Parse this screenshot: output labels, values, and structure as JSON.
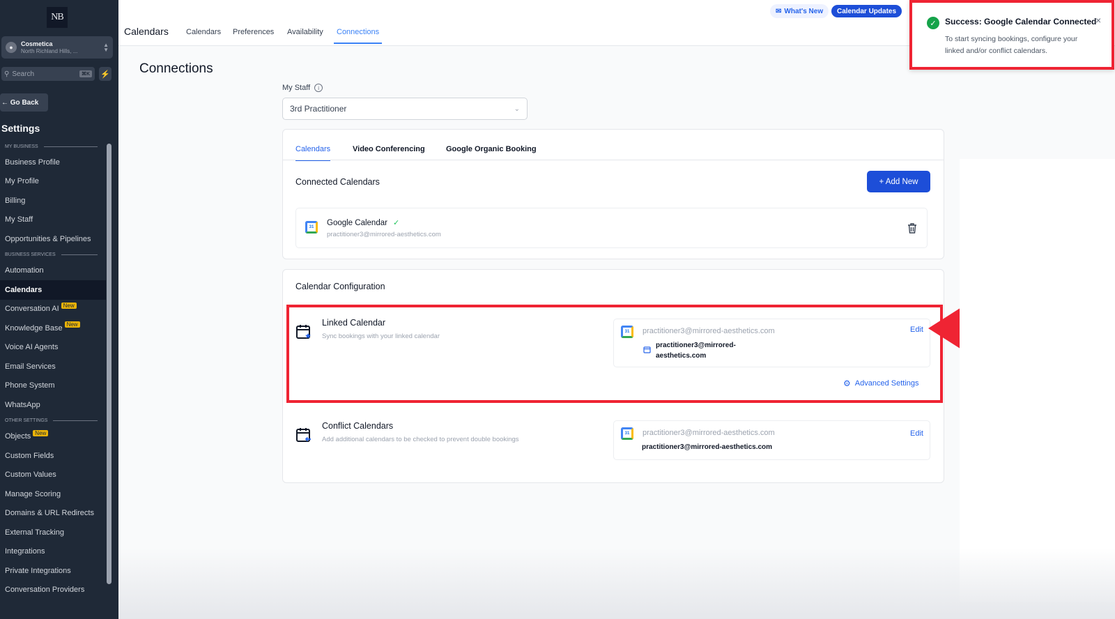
{
  "sidebar": {
    "logo": "NB",
    "account": {
      "name": "Cosmetica",
      "location": "North Richland Hills, ..."
    },
    "search": {
      "placeholder": "Search",
      "shortcut": "⌘K"
    },
    "go_back": "← Go Back",
    "title": "Settings",
    "sections": [
      {
        "label": "MY BUSINESS",
        "items": [
          {
            "label": "Business Profile"
          },
          {
            "label": "My Profile"
          },
          {
            "label": "Billing"
          },
          {
            "label": "My Staff"
          },
          {
            "label": "Opportunities & Pipelines"
          }
        ]
      },
      {
        "label": "BUSINESS SERVICES",
        "items": [
          {
            "label": "Automation"
          },
          {
            "label": "Calendars",
            "active": true
          },
          {
            "label": "Conversation AI",
            "badge": "New"
          },
          {
            "label": "Knowledge Base",
            "badge": "New"
          },
          {
            "label": "Voice AI Agents"
          },
          {
            "label": "Email Services"
          },
          {
            "label": "Phone System"
          },
          {
            "label": "WhatsApp"
          }
        ]
      },
      {
        "label": "OTHER SETTINGS",
        "items": [
          {
            "label": "Objects",
            "badge": "New"
          },
          {
            "label": "Custom Fields"
          },
          {
            "label": "Custom Values"
          },
          {
            "label": "Manage Scoring"
          },
          {
            "label": "Domains & URL Redirects"
          },
          {
            "label": "External Tracking"
          },
          {
            "label": "Integrations"
          },
          {
            "label": "Private Integrations"
          },
          {
            "label": "Conversation Providers"
          }
        ]
      }
    ]
  },
  "topbar": {
    "title": "Calendars",
    "tabs": [
      "Calendars",
      "Preferences",
      "Availability",
      "Connections"
    ],
    "active_tab": "Connections",
    "whats_new": "What's New",
    "calendar_updates": "Calendar Updates"
  },
  "page": {
    "heading": "Connections"
  },
  "staff": {
    "label": "My Staff",
    "selected": "3rd Practitioner"
  },
  "connections": {
    "tabs": [
      "Calendars",
      "Video Conferencing",
      "Google Organic Booking"
    ],
    "connected_title": "Connected Calendars",
    "add_new": "+ Add New",
    "google": {
      "name": "Google Calendar",
      "email": "practitioner3@mirrored-aesthetics.com"
    }
  },
  "config": {
    "title": "Calendar Configuration",
    "linked": {
      "title": "Linked Calendar",
      "desc": "Sync bookings with your linked calendar",
      "account": "practitioner3@mirrored-aesthetics.com",
      "calendar_line1": "practitioner3@mirrored-",
      "calendar_line2": "aesthetics.com",
      "edit": "Edit",
      "advanced": "Advanced Settings"
    },
    "conflict": {
      "title": "Conflict Calendars",
      "desc": "Add additional calendars to be checked to prevent double bookings",
      "account": "practitioner3@mirrored-aesthetics.com",
      "calendar": "practitioner3@mirrored-aesthetics.com",
      "edit": "Edit"
    }
  },
  "toast": {
    "title": "Success: Google Calendar Connected",
    "body": "To start syncing bookings, configure your linked and/or conflict calendars.",
    "close": "×"
  },
  "colors": {
    "accent": "#2563eb",
    "sidebar": "#1f2937",
    "highlight": "#ef2433",
    "success": "#16a34a"
  }
}
